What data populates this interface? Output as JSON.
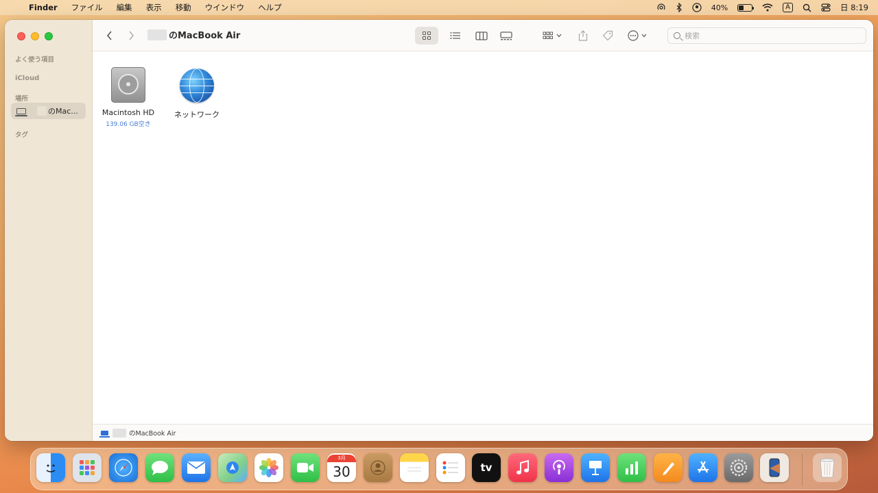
{
  "menubar": {
    "app_name": "Finder",
    "menus": [
      "ファイル",
      "編集",
      "表示",
      "移動",
      "ウインドウ",
      "ヘルプ"
    ],
    "battery_percent": "40%",
    "battery_level": 0.4,
    "input_mode": "A",
    "clock": "日 8:19"
  },
  "sidebar": {
    "favorites_header": "よく使う項目",
    "icloud_header": "iCloud",
    "locations_header": "場所",
    "location_item_label": "のMac...",
    "tags_header": "タグ"
  },
  "toolbar": {
    "title": "のMacBook Air",
    "search_placeholder": "検索"
  },
  "content": {
    "items": [
      {
        "label": "Macintosh HD",
        "sublabel": "139.06 GB空き"
      },
      {
        "label": "ネットワーク"
      }
    ]
  },
  "pathbar": {
    "path": "のMacBook Air"
  },
  "dock": {
    "calendar_month": "3月",
    "calendar_day": "30",
    "tv_label": "tv"
  }
}
